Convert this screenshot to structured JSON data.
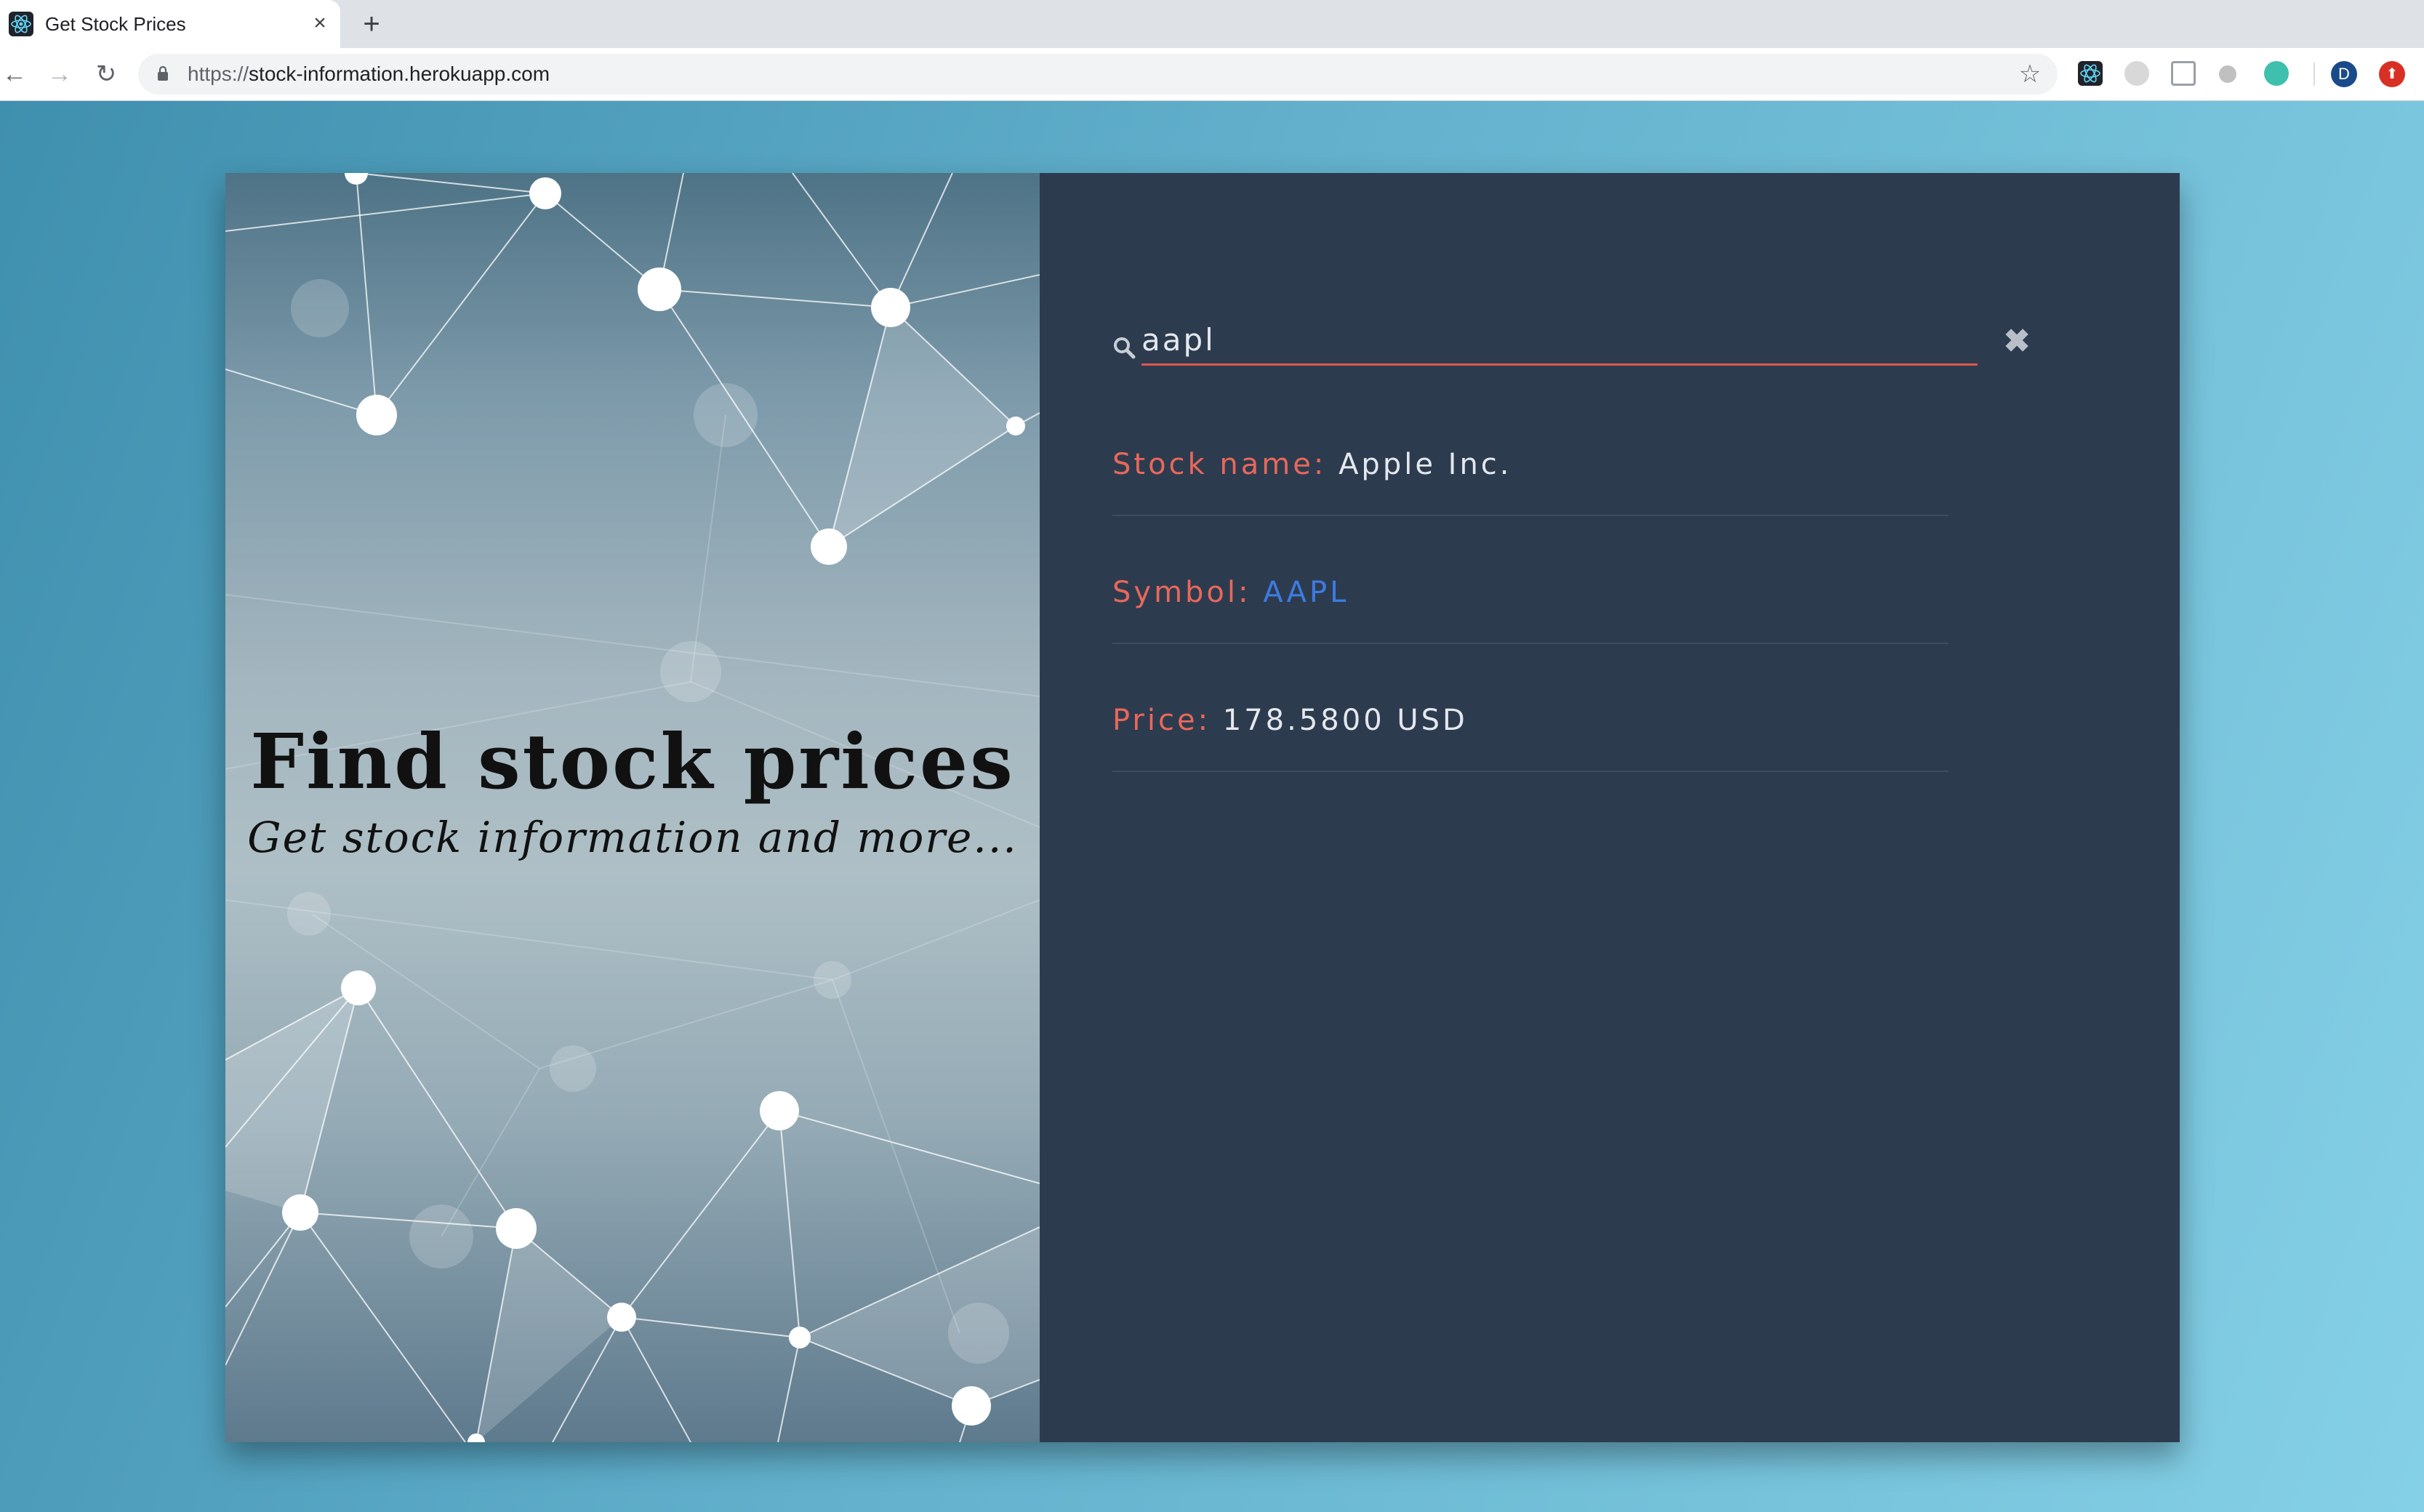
{
  "browser": {
    "tab_title": "Get Stock Prices",
    "tab_close": "×",
    "new_tab": "+",
    "url_scheme": "https://",
    "url_host": "stock-information.herokuapp.com",
    "avatar_letter": "D",
    "icons": {
      "back": "arrow-left-icon",
      "forward": "arrow-right-icon",
      "reload": "reload-icon",
      "lock": "lock-icon",
      "bookmark": "star-icon",
      "favicon": "react-logo-icon"
    }
  },
  "hero": {
    "title": "Find stock prices",
    "subtitle": "Get stock information and more..."
  },
  "search": {
    "value": "aapl",
    "clear_icon": "close-icon"
  },
  "results": {
    "stock_name_label": "Stock name:",
    "stock_name_value": "Apple Inc.",
    "symbol_label": "Symbol:",
    "symbol_value": "AAPL",
    "price_label": "Price:",
    "price_value": "178.5800 USD"
  },
  "colors": {
    "label_accent": "#e8685a",
    "link_blue": "#3d7be0",
    "panel_bg": "#2d3b4f",
    "input_underline": "#e0574a"
  }
}
